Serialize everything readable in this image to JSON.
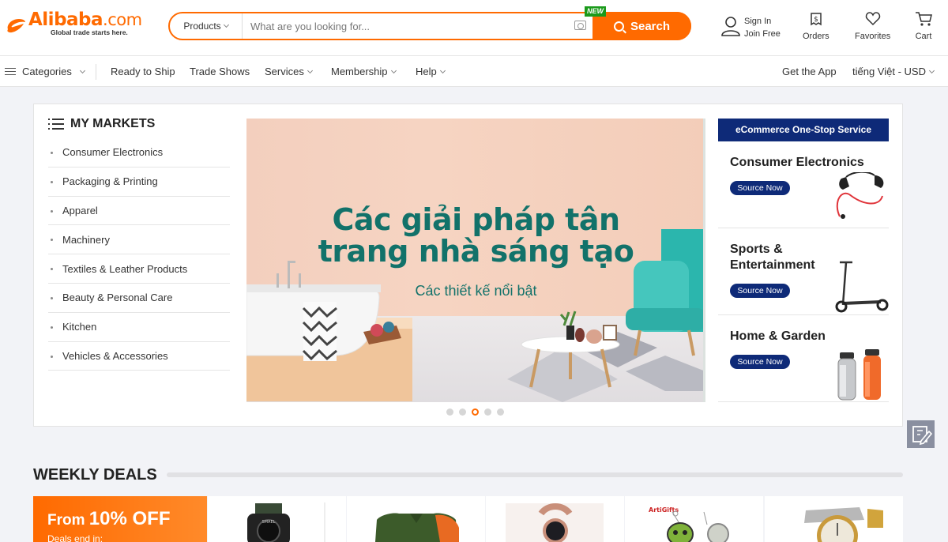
{
  "header": {
    "logo_text": "Alibaba",
    "logo_com": ".com",
    "logo_tagline": "Global trade starts here.",
    "search": {
      "category": "Products",
      "placeholder": "What are you looking for...",
      "button": "Search",
      "new_badge": "NEW"
    },
    "sign_in": "Sign In",
    "join_free": "Join Free",
    "orders": "Orders",
    "favorites": "Favorites",
    "cart": "Cart"
  },
  "nav": {
    "categories": "Categories",
    "ready_to_ship": "Ready to Ship",
    "trade_shows": "Trade Shows",
    "services": "Services",
    "membership": "Membership",
    "help": "Help",
    "get_app": "Get the App",
    "language_currency": "tiếng Việt - USD"
  },
  "markets": {
    "title": "MY MARKETS",
    "items": [
      "Consumer Electronics",
      "Packaging & Printing",
      "Apparel",
      "Machinery",
      "Textiles & Leather Products",
      "Beauty & Personal Care",
      "Kitchen",
      "Vehicles & Accessories"
    ]
  },
  "banner": {
    "title_line1": "Các giải pháp tân",
    "title_line2": "trang nhà sáng tạo",
    "subtitle": "Các thiết kế nổi bật",
    "dots_count": 5,
    "active_dot": 3
  },
  "ecommerce": {
    "heading": "eCommerce One-Stop Service",
    "items": [
      {
        "title": "Consumer Electronics",
        "button": "Source Now",
        "image": "headphones"
      },
      {
        "title": "Sports & Entertainment",
        "button": "Source Now",
        "image": "scooter"
      },
      {
        "title": "Home & Garden",
        "button": "Source Now",
        "image": "bottles"
      }
    ]
  },
  "weekly_deals": {
    "title": "WEEKLY DEALS",
    "promo_prefix": "From",
    "promo_value": "10% OFF",
    "promo_note": "Deals end in:",
    "deal_images": [
      "watch-icon",
      "jacket-icon",
      "watch-rosegold-icon",
      "keychain-icon",
      "watch-gold-icon"
    ]
  },
  "colors": {
    "brand": "#ff6a00",
    "navy": "#0e2a78",
    "banner_text": "#12726a"
  }
}
